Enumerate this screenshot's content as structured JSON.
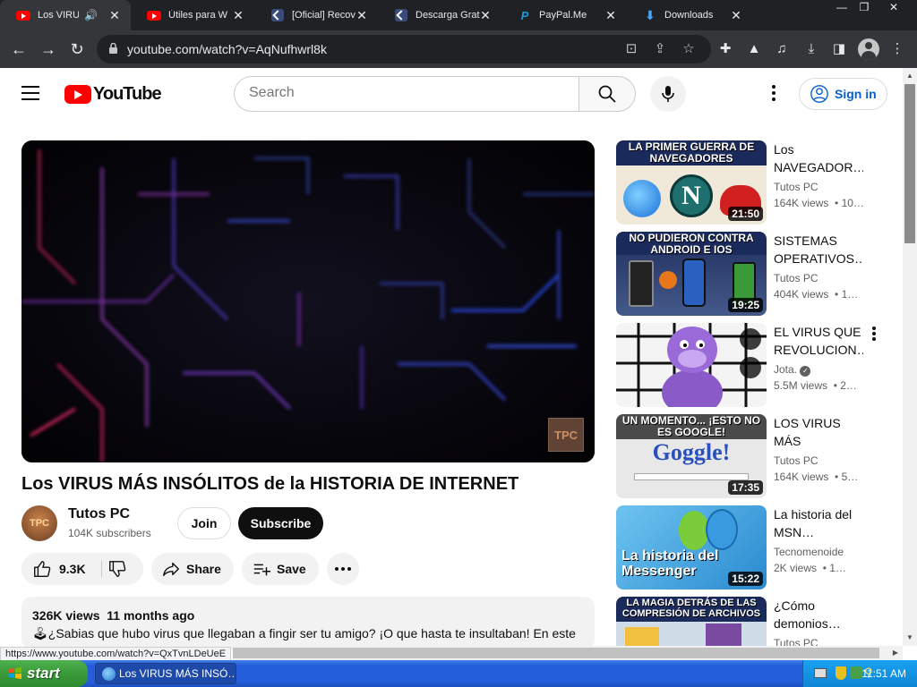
{
  "browser": {
    "tabs": [
      {
        "label": "Los VIRU",
        "icon": "youtube-icon",
        "active": true,
        "audio": true
      },
      {
        "label": "Útiles para W",
        "icon": "youtube-icon"
      },
      {
        "label": "[Oficial] Recov",
        "icon": "recoverit-icon"
      },
      {
        "label": "Descarga Grat",
        "icon": "recoverit-icon"
      },
      {
        "label": "PayPal.Me",
        "icon": "paypal-icon"
      },
      {
        "label": "Downloads",
        "icon": "download-icon"
      }
    ],
    "url": "youtube.com/watch?v=AqNufhwrl8k",
    "status_url": "https://www.youtube.com/watch?v=QxTvnLDeUeE"
  },
  "youtube": {
    "logo_text": "YouTube",
    "search_placeholder": "Search",
    "sign_in": "Sign in"
  },
  "video": {
    "title": "Los VIRUS MÁS INSÓLITOS de la HISTORIA DE INTERNET",
    "watermark": "TPC",
    "channel": {
      "name": "Tutos PC",
      "subscribers": "104K subscribers",
      "avatar_text": "TPC"
    },
    "join_label": "Join",
    "subscribe_label": "Subscribe",
    "likes": "9.3K",
    "share_label": "Share",
    "save_label": "Save",
    "description": {
      "views": "326K views",
      "age": "11 months ago",
      "text": "🕹¿Sabias que hubo virus que llegaban a fingir ser tu amigo? ¡O que hasta te insultaban! En este"
    }
  },
  "related": [
    {
      "title": "Los NAVEGADOR…",
      "channel": "Tutos PC",
      "views": "164K views",
      "age": "• 10…",
      "duration": "21:50",
      "caption": "LA PRIMER GUERRA DE NAVEGADORES"
    },
    {
      "title": "SISTEMAS OPERATIVOS…",
      "channel": "Tutos PC",
      "views": "404K views",
      "age": "• 1…",
      "duration": "19:25",
      "caption": "NO PUDIERON CONTRA ANDROID E IOS"
    },
    {
      "title": "EL VIRUS QUE REVOLUCION…",
      "channel": "Jota.",
      "views": "5.5M views",
      "age": "• 2…",
      "duration": "",
      "caption": ""
    },
    {
      "title": "LOS VIRUS MÁS INGENIOSOS…",
      "channel": "Tutos PC",
      "views": "164K views",
      "age": "• 5…",
      "duration": "17:35",
      "caption": "UN MOMENTO... ¡ESTO NO ES GOOGLE!",
      "logo_text": "Goggle!"
    },
    {
      "title": "La historia del MSN…",
      "channel": "Tecnomenoide",
      "views": "2K views",
      "age": "• 1…",
      "duration": "15:22",
      "caption": "La historia del Messenger"
    },
    {
      "title": "¿Cómo demonios…",
      "channel": "Tutos PC",
      "views": "",
      "age": "",
      "duration": "",
      "caption": "LA MAGIA DETRÁS DE LAS COMPRESIÓN DE ARCHIVOS"
    }
  ],
  "taskbar": {
    "start_label": "start",
    "window_label": "Los VIRUS MÁS INSÓ…",
    "clock": "11:51 AM"
  },
  "colors": {
    "yt_red": "#ff0000",
    "chrome_dark": "#202124",
    "chrome_toolbar": "#35363a",
    "link_blue": "#065fd4",
    "xp_blue": "#245edb",
    "xp_green": "#3a9a3a"
  }
}
